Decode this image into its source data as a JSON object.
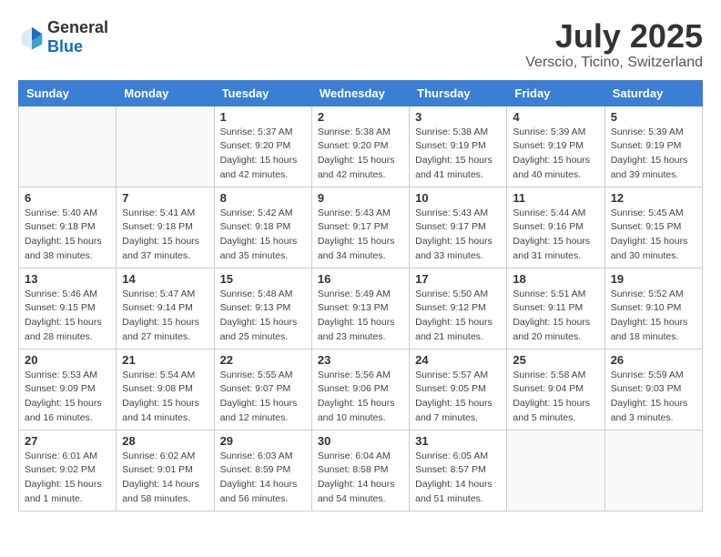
{
  "header": {
    "logo_general": "General",
    "logo_blue": "Blue",
    "month": "July 2025",
    "location": "Verscio, Ticino, Switzerland"
  },
  "weekdays": [
    "Sunday",
    "Monday",
    "Tuesday",
    "Wednesday",
    "Thursday",
    "Friday",
    "Saturday"
  ],
  "weeks": [
    [
      {
        "day": "",
        "sunrise": "",
        "sunset": "",
        "daylight": ""
      },
      {
        "day": "",
        "sunrise": "",
        "sunset": "",
        "daylight": ""
      },
      {
        "day": "1",
        "sunrise": "Sunrise: 5:37 AM",
        "sunset": "Sunset: 9:20 PM",
        "daylight": "Daylight: 15 hours and 42 minutes."
      },
      {
        "day": "2",
        "sunrise": "Sunrise: 5:38 AM",
        "sunset": "Sunset: 9:20 PM",
        "daylight": "Daylight: 15 hours and 42 minutes."
      },
      {
        "day": "3",
        "sunrise": "Sunrise: 5:38 AM",
        "sunset": "Sunset: 9:19 PM",
        "daylight": "Daylight: 15 hours and 41 minutes."
      },
      {
        "day": "4",
        "sunrise": "Sunrise: 5:39 AM",
        "sunset": "Sunset: 9:19 PM",
        "daylight": "Daylight: 15 hours and 40 minutes."
      },
      {
        "day": "5",
        "sunrise": "Sunrise: 5:39 AM",
        "sunset": "Sunset: 9:19 PM",
        "daylight": "Daylight: 15 hours and 39 minutes."
      }
    ],
    [
      {
        "day": "6",
        "sunrise": "Sunrise: 5:40 AM",
        "sunset": "Sunset: 9:18 PM",
        "daylight": "Daylight: 15 hours and 38 minutes."
      },
      {
        "day": "7",
        "sunrise": "Sunrise: 5:41 AM",
        "sunset": "Sunset: 9:18 PM",
        "daylight": "Daylight: 15 hours and 37 minutes."
      },
      {
        "day": "8",
        "sunrise": "Sunrise: 5:42 AM",
        "sunset": "Sunset: 9:18 PM",
        "daylight": "Daylight: 15 hours and 35 minutes."
      },
      {
        "day": "9",
        "sunrise": "Sunrise: 5:43 AM",
        "sunset": "Sunset: 9:17 PM",
        "daylight": "Daylight: 15 hours and 34 minutes."
      },
      {
        "day": "10",
        "sunrise": "Sunrise: 5:43 AM",
        "sunset": "Sunset: 9:17 PM",
        "daylight": "Daylight: 15 hours and 33 minutes."
      },
      {
        "day": "11",
        "sunrise": "Sunrise: 5:44 AM",
        "sunset": "Sunset: 9:16 PM",
        "daylight": "Daylight: 15 hours and 31 minutes."
      },
      {
        "day": "12",
        "sunrise": "Sunrise: 5:45 AM",
        "sunset": "Sunset: 9:15 PM",
        "daylight": "Daylight: 15 hours and 30 minutes."
      }
    ],
    [
      {
        "day": "13",
        "sunrise": "Sunrise: 5:46 AM",
        "sunset": "Sunset: 9:15 PM",
        "daylight": "Daylight: 15 hours and 28 minutes."
      },
      {
        "day": "14",
        "sunrise": "Sunrise: 5:47 AM",
        "sunset": "Sunset: 9:14 PM",
        "daylight": "Daylight: 15 hours and 27 minutes."
      },
      {
        "day": "15",
        "sunrise": "Sunrise: 5:48 AM",
        "sunset": "Sunset: 9:13 PM",
        "daylight": "Daylight: 15 hours and 25 minutes."
      },
      {
        "day": "16",
        "sunrise": "Sunrise: 5:49 AM",
        "sunset": "Sunset: 9:13 PM",
        "daylight": "Daylight: 15 hours and 23 minutes."
      },
      {
        "day": "17",
        "sunrise": "Sunrise: 5:50 AM",
        "sunset": "Sunset: 9:12 PM",
        "daylight": "Daylight: 15 hours and 21 minutes."
      },
      {
        "day": "18",
        "sunrise": "Sunrise: 5:51 AM",
        "sunset": "Sunset: 9:11 PM",
        "daylight": "Daylight: 15 hours and 20 minutes."
      },
      {
        "day": "19",
        "sunrise": "Sunrise: 5:52 AM",
        "sunset": "Sunset: 9:10 PM",
        "daylight": "Daylight: 15 hours and 18 minutes."
      }
    ],
    [
      {
        "day": "20",
        "sunrise": "Sunrise: 5:53 AM",
        "sunset": "Sunset: 9:09 PM",
        "daylight": "Daylight: 15 hours and 16 minutes."
      },
      {
        "day": "21",
        "sunrise": "Sunrise: 5:54 AM",
        "sunset": "Sunset: 9:08 PM",
        "daylight": "Daylight: 15 hours and 14 minutes."
      },
      {
        "day": "22",
        "sunrise": "Sunrise: 5:55 AM",
        "sunset": "Sunset: 9:07 PM",
        "daylight": "Daylight: 15 hours and 12 minutes."
      },
      {
        "day": "23",
        "sunrise": "Sunrise: 5:56 AM",
        "sunset": "Sunset: 9:06 PM",
        "daylight": "Daylight: 15 hours and 10 minutes."
      },
      {
        "day": "24",
        "sunrise": "Sunrise: 5:57 AM",
        "sunset": "Sunset: 9:05 PM",
        "daylight": "Daylight: 15 hours and 7 minutes."
      },
      {
        "day": "25",
        "sunrise": "Sunrise: 5:58 AM",
        "sunset": "Sunset: 9:04 PM",
        "daylight": "Daylight: 15 hours and 5 minutes."
      },
      {
        "day": "26",
        "sunrise": "Sunrise: 5:59 AM",
        "sunset": "Sunset: 9:03 PM",
        "daylight": "Daylight: 15 hours and 3 minutes."
      }
    ],
    [
      {
        "day": "27",
        "sunrise": "Sunrise: 6:01 AM",
        "sunset": "Sunset: 9:02 PM",
        "daylight": "Daylight: 15 hours and 1 minute."
      },
      {
        "day": "28",
        "sunrise": "Sunrise: 6:02 AM",
        "sunset": "Sunset: 9:01 PM",
        "daylight": "Daylight: 14 hours and 58 minutes."
      },
      {
        "day": "29",
        "sunrise": "Sunrise: 6:03 AM",
        "sunset": "Sunset: 8:59 PM",
        "daylight": "Daylight: 14 hours and 56 minutes."
      },
      {
        "day": "30",
        "sunrise": "Sunrise: 6:04 AM",
        "sunset": "Sunset: 8:58 PM",
        "daylight": "Daylight: 14 hours and 54 minutes."
      },
      {
        "day": "31",
        "sunrise": "Sunrise: 6:05 AM",
        "sunset": "Sunset: 8:57 PM",
        "daylight": "Daylight: 14 hours and 51 minutes."
      },
      {
        "day": "",
        "sunrise": "",
        "sunset": "",
        "daylight": ""
      },
      {
        "day": "",
        "sunrise": "",
        "sunset": "",
        "daylight": ""
      }
    ]
  ]
}
